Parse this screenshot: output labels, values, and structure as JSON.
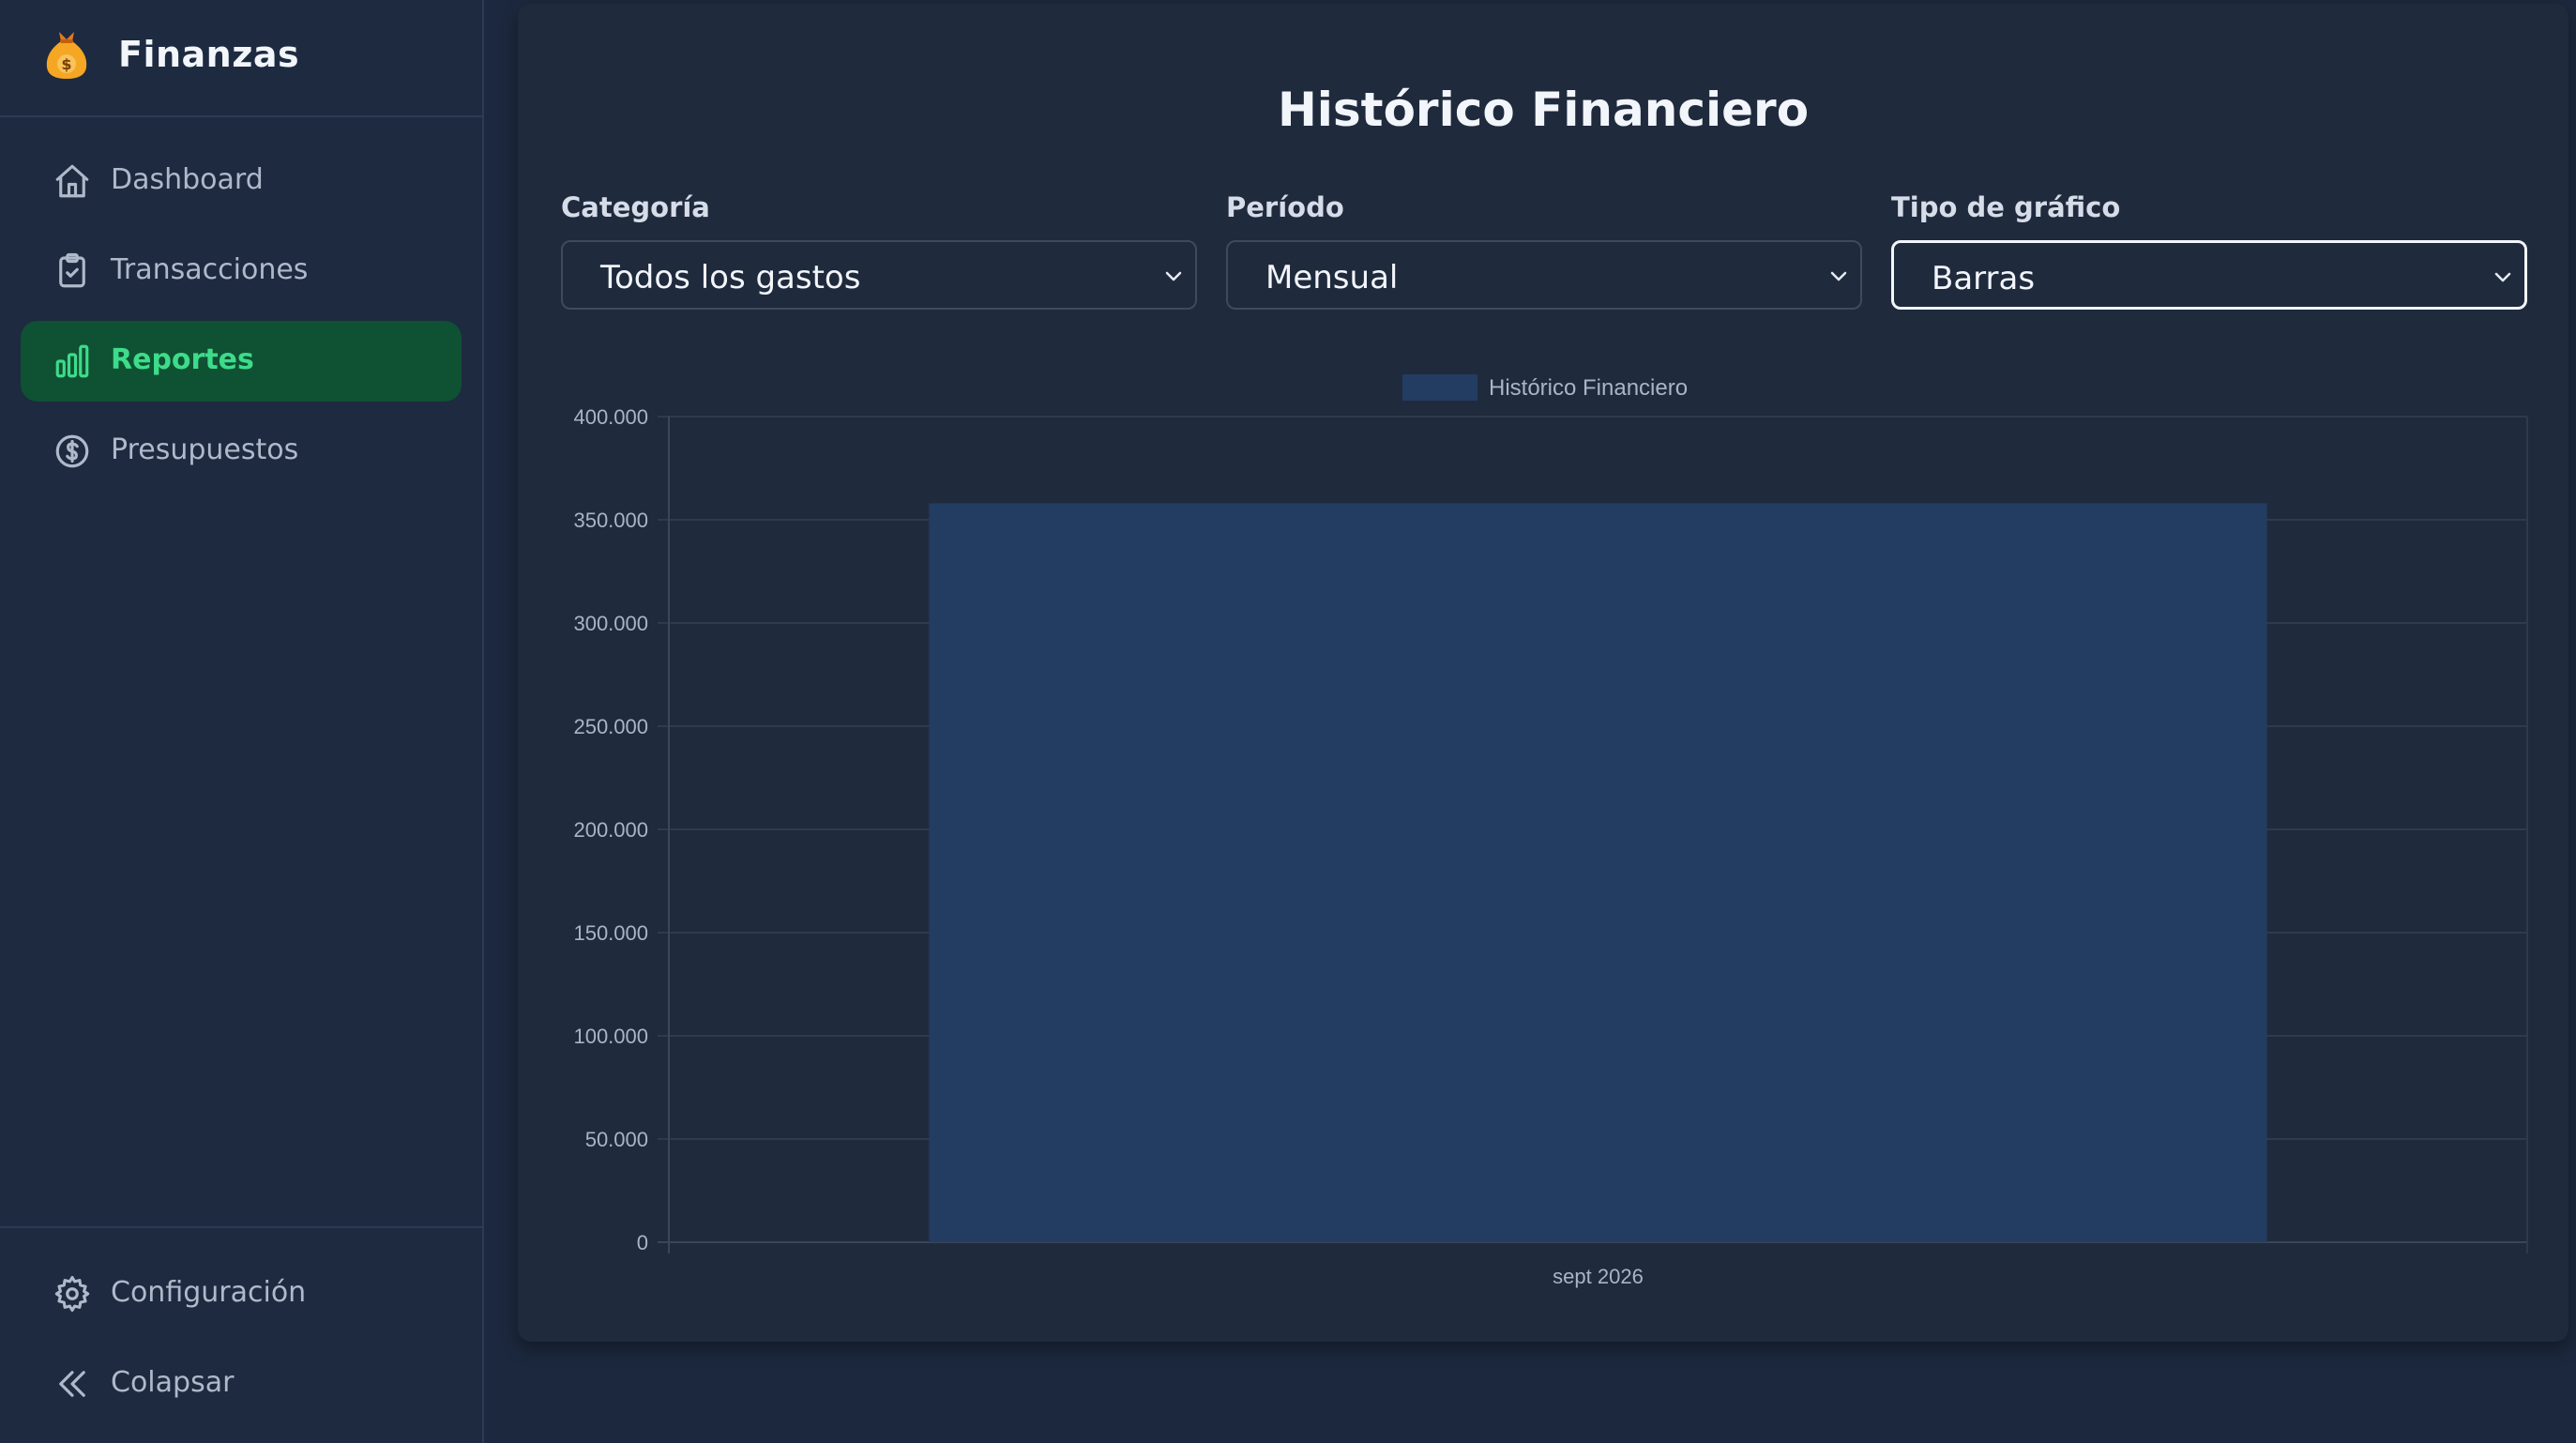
{
  "sidebar": {
    "brand": "Finanzas",
    "items": [
      {
        "label": "Dashboard",
        "icon": "home-icon"
      },
      {
        "label": "Transacciones",
        "icon": "clipboard-check-icon"
      },
      {
        "label": "Reportes",
        "icon": "bar-chart-icon",
        "active": true
      },
      {
        "label": "Presupuestos",
        "icon": "dollar-circle-icon"
      }
    ],
    "footer": [
      {
        "label": "Configuración",
        "icon": "gear-icon"
      },
      {
        "label": "Colapsar",
        "icon": "double-chevron-left-icon"
      }
    ]
  },
  "main": {
    "title": "Histórico Financiero",
    "filters": {
      "category": {
        "label": "Categoría",
        "value": "Todos los gastos"
      },
      "period": {
        "label": "Período",
        "value": "Mensual"
      },
      "chart_type": {
        "label": "Tipo de gráfico",
        "value": "Barras"
      }
    }
  },
  "colors": {
    "accent": "#3ddc8a",
    "active_bg": "#0f5133",
    "bar": "#233c62"
  },
  "chart_data": {
    "type": "bar",
    "categories": [
      "sept 2026"
    ],
    "series": [
      {
        "name": "Histórico Financiero",
        "values": [
          358000
        ]
      }
    ],
    "ylim": [
      0,
      400000
    ],
    "yticks": [
      "0",
      "50.000",
      "100.000",
      "150.000",
      "200.000",
      "250.000",
      "300.000",
      "350.000",
      "400.000"
    ],
    "grid": true,
    "legend": "top-center"
  }
}
